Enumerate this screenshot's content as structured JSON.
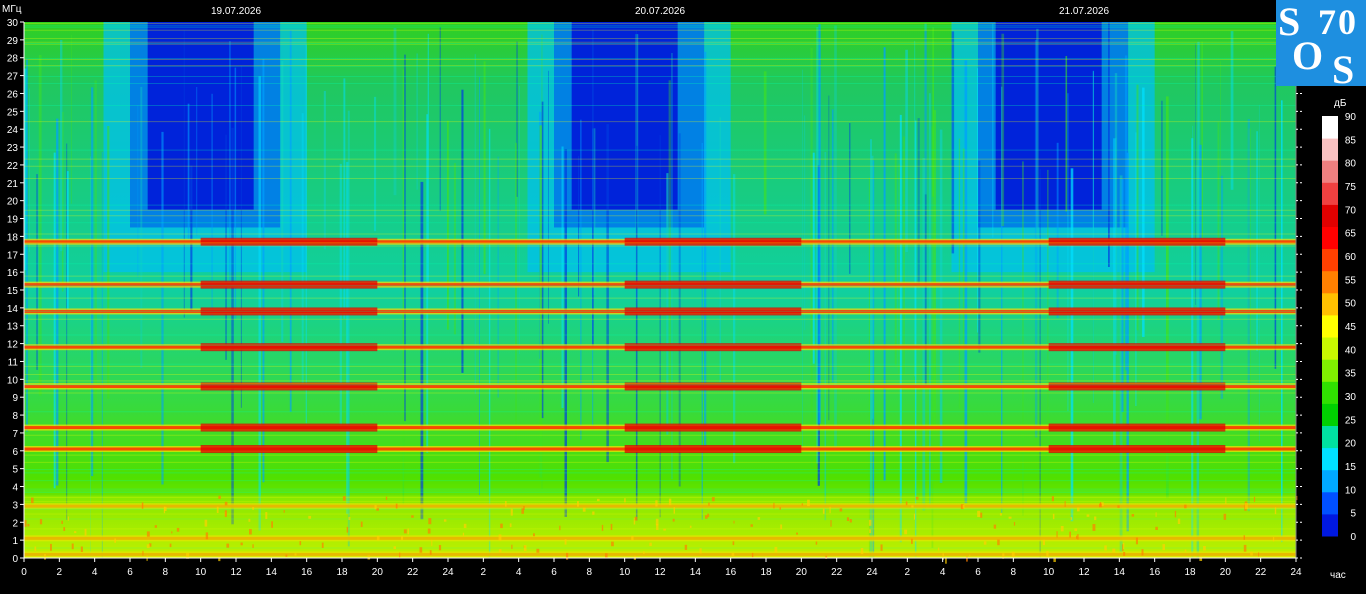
{
  "chart_data": {
    "type": "heatmap",
    "y_unit_label": "МГц",
    "x_unit_label": "час",
    "colorbar_unit_label": "дБ",
    "dates": [
      "19.07.2026",
      "20.07.2026",
      "21.07.2026"
    ],
    "x_ticks": [
      "0",
      "2",
      "4",
      "6",
      "8",
      "10",
      "12",
      "14",
      "16",
      "18",
      "20",
      "22",
      "24",
      "2",
      "4",
      "6",
      "8",
      "10",
      "12",
      "14",
      "16",
      "18",
      "20",
      "22",
      "24",
      "2",
      "4",
      "6",
      "8",
      "10",
      "12",
      "14",
      "16",
      "18",
      "20",
      "22",
      "24"
    ],
    "y_ticks": [
      "0",
      "1",
      "2",
      "3",
      "4",
      "5",
      "6",
      "7",
      "8",
      "9",
      "10",
      "11",
      "12",
      "13",
      "14",
      "15",
      "16",
      "17",
      "18",
      "19",
      "20",
      "21",
      "22",
      "23",
      "24",
      "25",
      "26",
      "27",
      "28",
      "29",
      "30"
    ],
    "xlim_hours": [
      0,
      72
    ],
    "ylim_mhz": [
      0,
      30
    ],
    "colorbar_ticks": [
      "0",
      "5",
      "10",
      "15",
      "20",
      "25",
      "30",
      "35",
      "40",
      "45",
      "50",
      "55",
      "60",
      "65",
      "70",
      "75",
      "80",
      "85",
      "90"
    ],
    "colorbar_colors": [
      "#0018e0",
      "#0050ff",
      "#00a8ff",
      "#00e0ff",
      "#00e0a0",
      "#00d000",
      "#30e000",
      "#80f000",
      "#c8f800",
      "#ffff00",
      "#ffc000",
      "#ff8000",
      "#ff4000",
      "#ff0000",
      "#e00000",
      "#f04040",
      "#f08080",
      "#f8c0c0",
      "#ffffff"
    ],
    "grid": false,
    "persistent_bands_mhz": [
      0.2,
      1.1,
      2.9,
      6.1,
      7.3,
      9.6,
      11.8,
      13.8,
      15.3,
      17.7
    ]
  },
  "logo": {
    "bg_color": "#1e8fe0",
    "glyphs": [
      "S",
      "7",
      "0",
      "O",
      "S"
    ]
  }
}
